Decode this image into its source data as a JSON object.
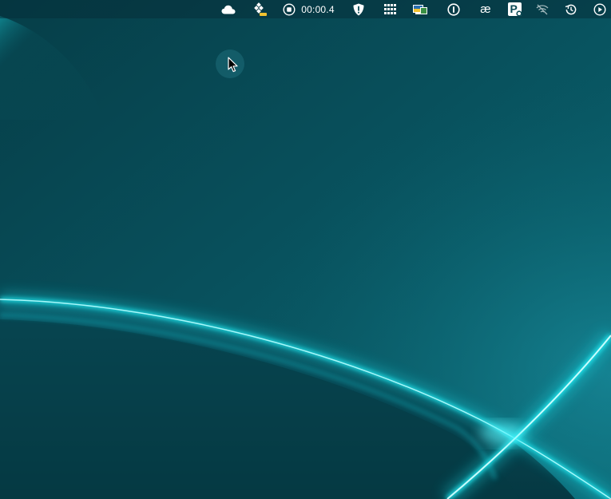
{
  "desktop": {
    "wallpaper_name": "teal-light-arcs-wallpaper",
    "colors": {
      "background_dark": "#063842",
      "background_mid": "#0b5664",
      "arc_glow": "#15e6ef",
      "arc_core": "#9ffcff"
    }
  },
  "menubar": {
    "items": [
      {
        "name": "cloud-icon"
      },
      {
        "name": "app-status-icon"
      },
      {
        "name": "screen-record-stop-icon"
      },
      {
        "name": "shield-alert-icon"
      },
      {
        "name": "grid-apps-icon"
      },
      {
        "name": "display-flag-icon"
      },
      {
        "name": "password-manager-icon"
      },
      {
        "name": "ae-text-expander-icon"
      },
      {
        "name": "p-badge-icon"
      },
      {
        "name": "wifi-off-icon"
      },
      {
        "name": "time-machine-icon"
      },
      {
        "name": "play-circle-icon"
      }
    ],
    "recording_timer": "00:00.4",
    "ae_glyph": "æ",
    "p_glyph": "P"
  },
  "cursor": {
    "icon": "arrow-pointer-icon"
  }
}
